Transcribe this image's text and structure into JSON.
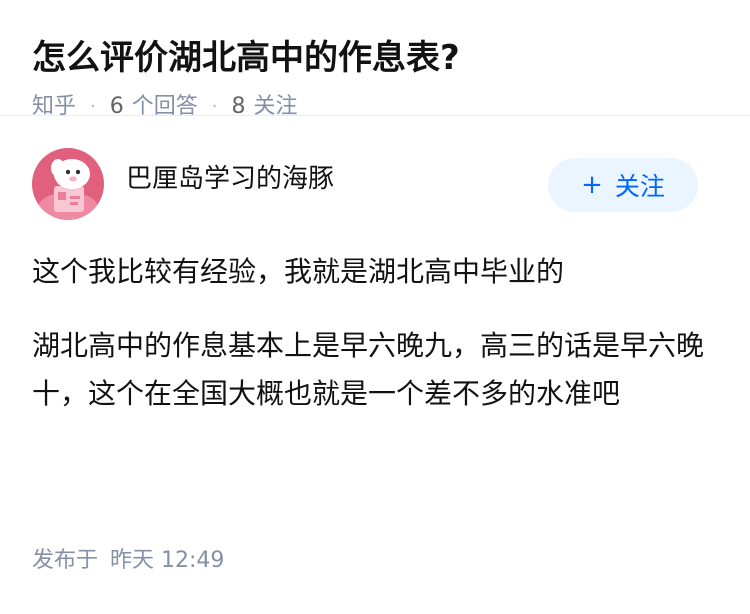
{
  "question": {
    "title": "怎么评价湖北高中的作息表?",
    "source": "知乎",
    "answer_count": "6",
    "answer_label": "个回答",
    "follower_count": "8",
    "follower_label": "关注"
  },
  "answer": {
    "author_name": "巴厘岛学习的海豚",
    "follow_button": {
      "icon": "plus-icon",
      "label": "关注"
    },
    "paragraphs": [
      "这个我比较有经验，我就是湖北高中毕业的",
      "湖北高中的作息基本上是早六晚九，高三的话是早六晚十，这个在全国大概也就是一个差不多的水准吧"
    ],
    "publish_label": "发布于",
    "publish_time": "昨天 12:49"
  },
  "colors": {
    "accent": "#0066ff",
    "follow_bg": "#ebf5ff",
    "meta_text": "#8590a6",
    "avatar_bg": "#e0607e"
  }
}
